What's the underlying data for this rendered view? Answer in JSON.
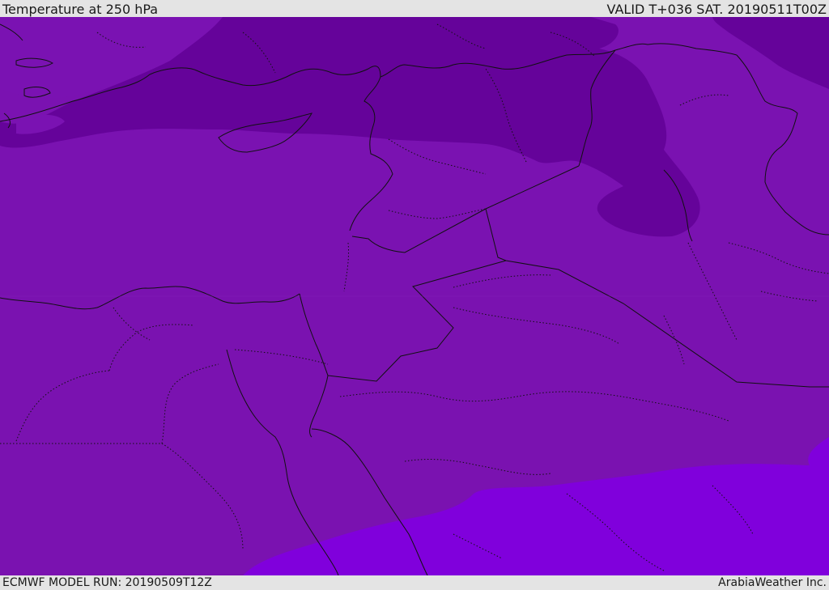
{
  "header": {
    "title": "Temperature at 250 hPa",
    "valid_time": "VALID T+036 SAT. 20190511T00Z"
  },
  "footer": {
    "model_run": "ECMWF MODEL RUN: 20190509T12Z",
    "credit": "ArabiaWeather Inc."
  },
  "map": {
    "field_colors": {
      "cold_band": "#65039a",
      "mid": "#7a12b0",
      "mid_south": "#7b10b8",
      "warm_south": "#8000dc"
    },
    "border_color": "#111111"
  }
}
